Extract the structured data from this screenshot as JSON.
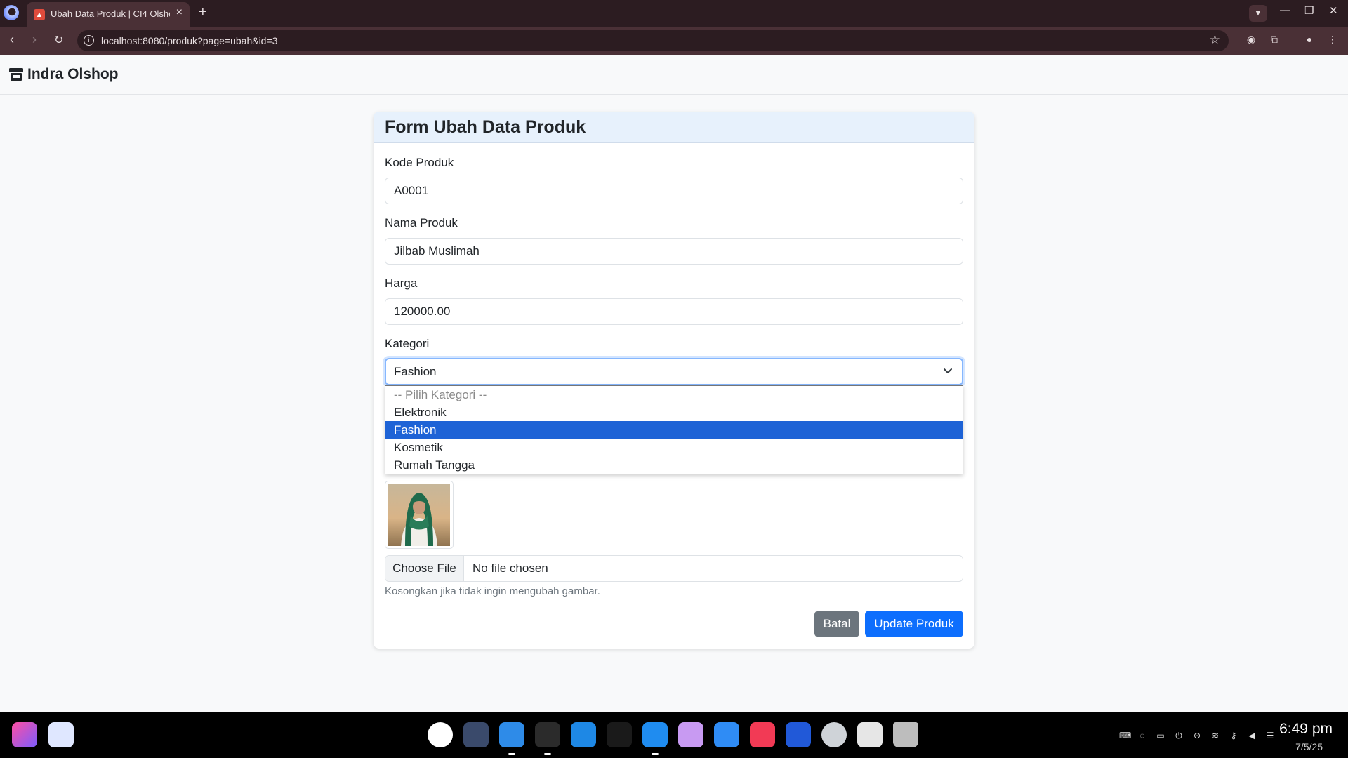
{
  "browser": {
    "tab_title": "Ubah Data Produk | CI4 Olshop",
    "url": "localhost:8080/produk?page=ubah&id=3"
  },
  "navbar": {
    "brand": "Indra Olshop"
  },
  "form": {
    "title": "Form Ubah Data Produk",
    "kode_label": "Kode Produk",
    "kode_value": "A0001",
    "nama_label": "Nama Produk",
    "nama_value": "Jilbab Muslimah",
    "harga_label": "Harga",
    "harga_value": "120000.00",
    "kategori_label": "Kategori",
    "kategori_value": "Fashion",
    "kategori_options": [
      {
        "label": "-- Pilih Kategori --",
        "state": "placeholder"
      },
      {
        "label": "Elektronik",
        "state": "normal"
      },
      {
        "label": "Fashion",
        "state": "selected"
      },
      {
        "label": "Kosmetik",
        "state": "normal"
      },
      {
        "label": "Rumah Tangga",
        "state": "normal"
      }
    ],
    "file_button": "Choose File",
    "file_status": "No file chosen",
    "file_help": "Kosongkan jika tidak ingin mengubah gambar.",
    "cancel_label": "Batal",
    "submit_label": "Update Produk"
  },
  "taskbar": {
    "time": "6:49 pm",
    "date": "7/5/25"
  },
  "colors": {
    "primary": "#0d6efd",
    "secondary": "#6c757d",
    "header_bg": "#e7f1fc",
    "selected_option": "#1e63d6",
    "chrome_bg": "#2c1c21"
  }
}
